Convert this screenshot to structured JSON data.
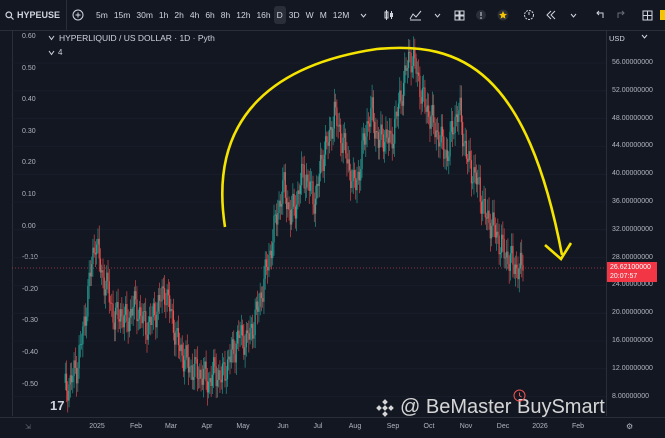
{
  "toolbar": {
    "symbol": "HYPEUSE",
    "timeframes": [
      "5m",
      "15m",
      "30m",
      "1h",
      "2h",
      "4h",
      "6h",
      "8h",
      "12h",
      "16h",
      "D",
      "3D",
      "W",
      "M",
      "12M"
    ],
    "active_timeframe": "D",
    "right_label": "[Y"
  },
  "legend": {
    "title": "HYPERLIQUID / US DOLLAR · 1D · Pyth",
    "indicator_count": "4"
  },
  "left_axis": [
    "0.60",
    "0.50",
    "0.40",
    "0.30",
    "0.20",
    "0.10",
    "0.00",
    "-0.10",
    "-0.20",
    "-0.30",
    "-0.40",
    "-0.50"
  ],
  "right_axis": {
    "currency": "USD",
    "ticks": [
      "56.00000000",
      "52.00000000",
      "48.00000000",
      "44.00000000",
      "40.00000000",
      "36.00000000",
      "32.00000000",
      "28.00000000",
      "24.00000000",
      "20.00000000",
      "16.00000000",
      "12.00000000",
      "8.00000000"
    ]
  },
  "x_axis": [
    "2025",
    "Feb",
    "Mar",
    "Apr",
    "May",
    "Jun",
    "Jul",
    "Aug",
    "Sep",
    "Oct",
    "Nov",
    "Dec",
    "2026",
    "Feb"
  ],
  "price_tag": {
    "price": "26.62100000",
    "countdown": "20:07:57"
  },
  "watermark": "@ BeMaster BuySmart",
  "colors": {
    "up": "#26a69a",
    "down": "#ef5350",
    "arc": "#f5e400",
    "tag": "#f23645",
    "bg": "#131722"
  },
  "icons": [
    "search-icon",
    "plus-icon",
    "chevron-down-icon",
    "candles-icon",
    "indicators-icon",
    "layout-icon",
    "alert-icon",
    "star-icon",
    "replay-icon",
    "undo-icon",
    "redo-icon",
    "fullscreen-icon",
    "tradingview-logo-icon",
    "binance-logo-icon"
  ],
  "chart_data": {
    "type": "candlestick",
    "x": [
      "2025",
      "Feb",
      "Mar",
      "Apr",
      "May",
      "Jun",
      "Jul",
      "Aug",
      "Sep",
      "Oct",
      "Nov",
      "Dec",
      "2026",
      "Feb"
    ],
    "ylim": [
      8,
      58
    ],
    "close": [
      10.5,
      11.5,
      13.5,
      18,
      25,
      31,
      26,
      24,
      20,
      21,
      19.5,
      22,
      21,
      19,
      20,
      22,
      24,
      21,
      17,
      15,
      13.5,
      13,
      12.5,
      11.5,
      13,
      12,
      14,
      16,
      18,
      17,
      19,
      22,
      26,
      30,
      35,
      38,
      34,
      36,
      40,
      38,
      36,
      42,
      44,
      48,
      45,
      42,
      38,
      40,
      46,
      48,
      44,
      45,
      44,
      48,
      52,
      56,
      54,
      50,
      48,
      46,
      44,
      42,
      47,
      48,
      42,
      40,
      38,
      34,
      33,
      31,
      29,
      28,
      27,
      26.6
    ],
    "last_price": 26.621
  }
}
